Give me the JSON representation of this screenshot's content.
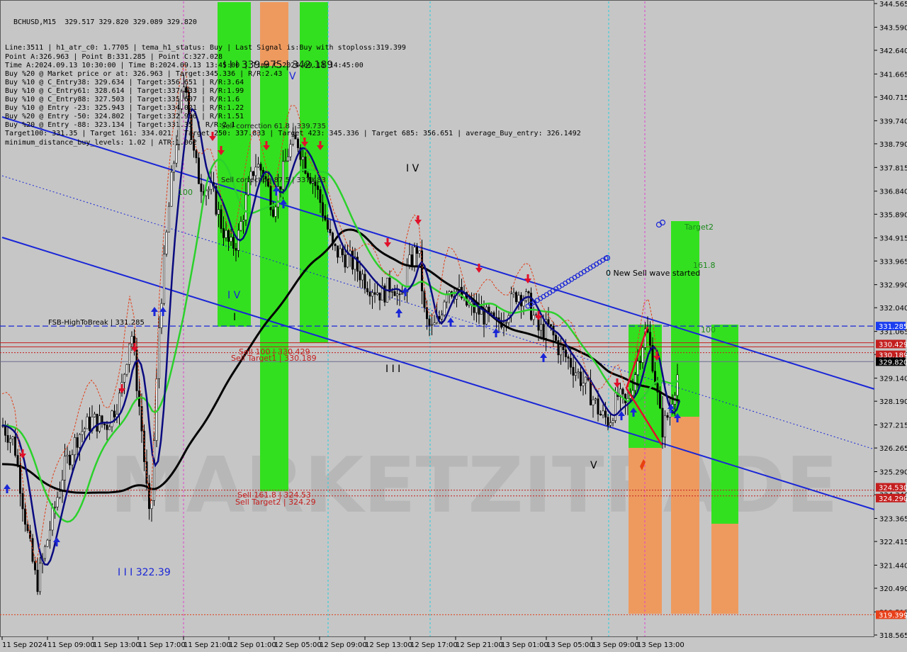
{
  "header": {
    "symbol_line": "BCHUSD,M15  329.517 329.820 329.089 329.820",
    "lines": [
      "Line:3511 | h1_atr_c0: 1.7705 | tema_h1_status: Buy | Last Signal is:Buy with stoploss:319.399",
      "Point A:326.963 | Point B:331.285 | Point C:327.028",
      "Time A:2024.09.13 10:30:00 | Time B:2024.09.13 13:45:00 | Time C:2024.09.13 14:45:00",
      "Buy %20 @ Market price or at: 326.963 | Target:345.336 | R/R:2.43",
      "Buy %10 @ C_Entry38: 329.634 | Target:356.651 | R/R:3.64",
      "Buy %10 @ C_Entry61: 328.614 | Target:337.833 | R/R:1.99",
      "Buy %10 @ C_Entry88: 327.503 | Target:335.607 | R/R:1.6",
      "Buy %10 @ Entry -23: 325.943 | Target:334.021 | R/R:1.22",
      "Buy %20 @ Entry -50: 324.802 | Target:332.936 | R/R:1.51",
      "Buy %20 @ Entry -88: 323.134 | Target:331.35 | R/R:2.1",
      "Target100: 331.35 | Target 161: 334.021 | Target 250: 337.833 | Target 423: 345.336 | Target 685: 356.651 | average_Buy_entry: 326.1492",
      "minimum_distance_buy_levels: 1.02 | ATR:1.062"
    ]
  },
  "price_axis": {
    "ticks": [
      "344.565",
      "343.590",
      "342.640",
      "341.665",
      "340.715",
      "339.740",
      "338.790",
      "337.815",
      "336.840",
      "335.890",
      "334.915",
      "333.965",
      "332.990",
      "332.040",
      "331.065",
      "330.115",
      "329.140",
      "328.190",
      "327.215",
      "326.265",
      "325.290",
      "324.340",
      "323.365",
      "322.415",
      "321.440",
      "320.490",
      "319.515",
      "318.565"
    ],
    "highlighted": [
      {
        "label": "331.285",
        "color": "#1a3df0"
      },
      {
        "label": "330.429",
        "color": "#c41e1e"
      },
      {
        "label": "330.189",
        "color": "#c41e1e"
      },
      {
        "label": "329.820",
        "color": "#000000"
      },
      {
        "label": "324.530",
        "color": "#c41e1e"
      },
      {
        "label": "324.290",
        "color": "#c41e1e"
      },
      {
        "label": "319.399",
        "color": "#e8401a"
      }
    ]
  },
  "time_axis": {
    "ticks": [
      "11 Sep 2024",
      "11 Sep 09:00",
      "11 Sep 13:00",
      "11 Sep 17:00",
      "11 Sep 21:00",
      "12 Sep 01:00",
      "12 Sep 05:00",
      "12 Sep 09:00",
      "12 Sep 13:00",
      "12 Sep 17:00",
      "12 Sep 21:00",
      "13 Sep 01:00",
      "13 Sep 05:00",
      "13 Sep 09:00",
      "13 Sep 13:00"
    ]
  },
  "annotations": {
    "fsb_high": "FSB-HighToBreak | 331.285",
    "sell100": "Sell 100 | 330.429",
    "sell_target1": "Sell Target1 | 330.189",
    "sell161": "Sell 161.8 | 324.53",
    "sell_target2": "Sell Target2 | 324.29",
    "low_322": "I I I 322.39",
    "wave_top": "I I I 339.975 | 342.189",
    "sell_corr_1": "Sell correction 61.8 | 339.735",
    "sell_corr_2": "Sell correction 87.5 | 337.483",
    "wave_iv_1": "I V",
    "wave_iv_2": "I V",
    "wave_iii": "I I I",
    "wave_v": "V",
    "wave_v_top": "V",
    "new_wave": "0 New Sell wave started",
    "target2": "Target2",
    "t1618": "161.8",
    "t100": "100",
    "t100_left": "100",
    "wave_i": "I"
  },
  "watermark": "MARKETZITRADE",
  "colors": {
    "background": "#c6c6c6",
    "bull_candle": "#000000",
    "bear_candle": "#000000",
    "channel": "#1a26d6",
    "ma_black": "#000000",
    "ma_navy": "#0a0a80",
    "ma_green": "#2bd12b",
    "stop_red": "#e0401a",
    "zone_green": "#33e01f",
    "zone_orange": "#f0a060"
  },
  "chart_data": {
    "type": "candlestick",
    "symbol": "BCHUSD",
    "timeframe": "M15",
    "y_range": [
      318.565,
      344.565
    ],
    "levels": {
      "fsb_high": 331.285,
      "sell100": 330.429,
      "sell_target1": 330.189,
      "last_price": 329.82,
      "sell161": 324.53,
      "sell_target2": 324.29,
      "stoploss": 319.399
    },
    "close_path": [
      [
        "11 Sep 2024",
        327.0
      ],
      [
        "11 Sep 09:00",
        322.6
      ],
      [
        "11 Sep 13:00",
        326.8
      ],
      [
        "11 Sep 17:00",
        328.9
      ],
      [
        "11 Sep 21:00",
        337.9
      ],
      [
        "12 Sep 01:00",
        335.3
      ],
      [
        "12 Sep 05:00",
        338.2
      ],
      [
        "12 Sep 09:00",
        334.2
      ],
      [
        "12 Sep 13:00",
        332.1
      ],
      [
        "12 Sep 17:00",
        332.5
      ],
      [
        "12 Sep 21:00",
        331.6
      ],
      [
        "13 Sep 01:00",
        332.0
      ],
      [
        "13 Sep 05:00",
        329.3
      ],
      [
        "13 Sep 09:00",
        327.9
      ],
      [
        "13 Sep 13:00",
        329.82
      ]
    ]
  }
}
